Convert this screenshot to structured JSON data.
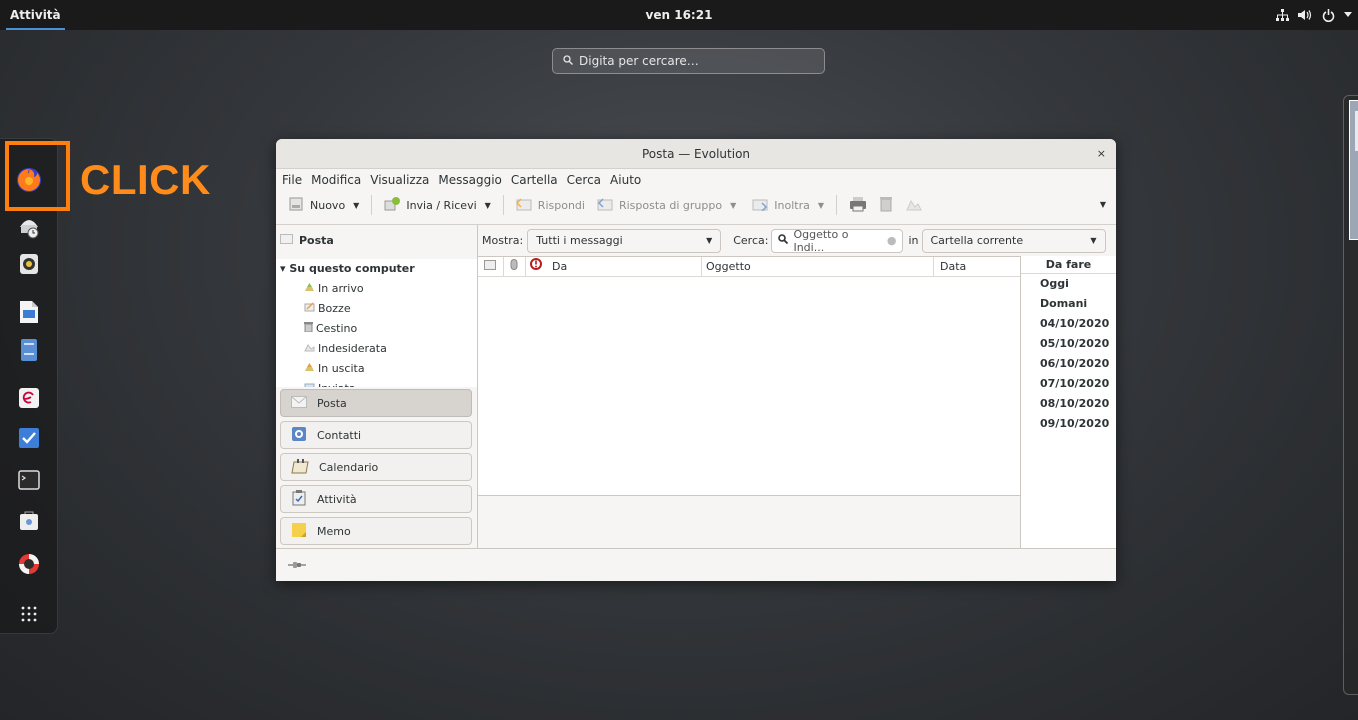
{
  "topbar": {
    "activities": "Attività",
    "clock": "ven 16:21",
    "tray_icons": [
      "network-icon",
      "volume-icon",
      "power-icon",
      "menu-arrow-icon"
    ]
  },
  "search": {
    "placeholder": "Digita per cercare…"
  },
  "dash": {
    "items": [
      "firefox",
      "evolution-mail",
      "rhythmbox",
      "writer",
      "files",
      "debian",
      "tasks",
      "terminal",
      "software",
      "help",
      "show-apps"
    ]
  },
  "annotation": {
    "label": "CLICK",
    "color": "#ff7f0e"
  },
  "window": {
    "title": "Posta — Evolution",
    "close": "×",
    "menu": [
      "File",
      "Modifica",
      "Visualizza",
      "Messaggio",
      "Cartella",
      "Cerca",
      "Aiuto"
    ],
    "toolbar": {
      "new": "Nuovo",
      "send_receive": "Invia / Ricevi",
      "reply": "Rispondi",
      "reply_group": "Risposta di gruppo",
      "forward": "Inoltra"
    },
    "left": {
      "header": "Posta",
      "root": "Su questo computer",
      "folders": [
        "In arrivo",
        "Bozze",
        "Cestino",
        "Indesiderata",
        "In uscita",
        "Inviata"
      ],
      "switcher": [
        "Posta",
        "Contatti",
        "Calendario",
        "Attività",
        "Memo"
      ]
    },
    "filter": {
      "show_label": "Mostra:",
      "show_value": "Tutti i messaggi",
      "search_label": "Cerca:",
      "search_placeholder": "Oggetto o Indi...",
      "in_label": "in",
      "scope_value": "Cartella corrente"
    },
    "columns": {
      "from": "Da",
      "subject": "Oggetto",
      "date": "Data"
    },
    "todo": {
      "header": "Da fare",
      "items": [
        "Oggi",
        "Domani",
        "04/10/2020",
        "05/10/2020",
        "06/10/2020",
        "07/10/2020",
        "08/10/2020",
        "09/10/2020"
      ]
    }
  }
}
